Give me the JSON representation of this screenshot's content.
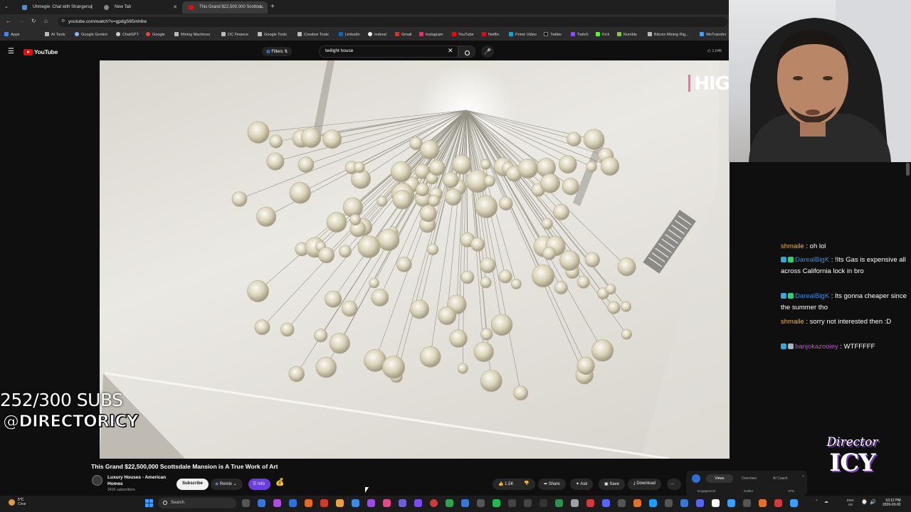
{
  "tabs": [
    {
      "title": "Uhmegle: Chat with Strangers |"
    },
    {
      "title": "New Tab"
    },
    {
      "title": "This Grand $22,500,000 Scottsd..."
    }
  ],
  "address": {
    "url": "youtube.com/watch?v=gpdgS65mh6w"
  },
  "bookmarks": [
    "Apps",
    "AI Tools",
    "Google Gemini",
    "ChatGPT",
    "Google",
    "Mining Machines",
    "DC Finance",
    "Google Tools",
    "Creative Tools",
    "LinkedIn",
    "Indeed",
    "Gmail",
    "Instagram",
    "YouTube",
    "Netflix",
    "Prime Video",
    "Twitter",
    "Twitch",
    "Kick",
    "Rumble",
    "Bitcoin Mining Rig...",
    "WeTransfer"
  ],
  "youtube": {
    "logo_text": "YouTube",
    "filters_label": "Filters",
    "search_value": "twilight house",
    "notif_count": "1,045"
  },
  "overlay": {
    "video_corner_text": "HIG",
    "subs_count": "252/300 SUBS",
    "handle": "@DIRECTORICY",
    "logo_top": "Director",
    "logo_bottom": "ICY"
  },
  "chat": [
    {
      "user": "shmaile",
      "text": " : oh lol",
      "badge": false
    },
    {
      "user": "DarealBigK",
      "text": " : !Its Gas is expensive all across California lock in bro",
      "badge": true
    },
    {
      "user": "DarealBigK",
      "text": " : Its gonna cheaper since the summer tho",
      "badge": true
    },
    {
      "user": "shmaile",
      "text": " : sorry not interested then :D",
      "badge": false
    },
    {
      "user": "banjokazooiey",
      "text": " : WTFFFFF",
      "badge": true
    }
  ],
  "video_info": {
    "title": "This Grand $22,500,000 Scottsdale Mansion is A True Work of Art",
    "channel_line1": "Luxury Houses - American",
    "channel_line2": "Homes",
    "subscribers": "241K subscribers",
    "subscribe_label": "Subscribe",
    "remix_label": "Remix",
    "info_label": "Info",
    "likes": "1.5K",
    "share_label": "Share",
    "ask_label": "Ask",
    "save_label": "Save",
    "download_label": "Download",
    "more_label": "...",
    "ext_tabs": [
      "Views",
      "Overview",
      "AI Coach"
    ],
    "ext_sub": [
      "Engagement",
      "Outlier",
      "VPH"
    ]
  },
  "taskbar": {
    "weather_temp": "5°C",
    "weather_desc": "Clear",
    "search_placeholder": "Search",
    "lang1": "ENG",
    "lang2": "US",
    "time": "10:12 PM",
    "date": "2026-03-02"
  }
}
